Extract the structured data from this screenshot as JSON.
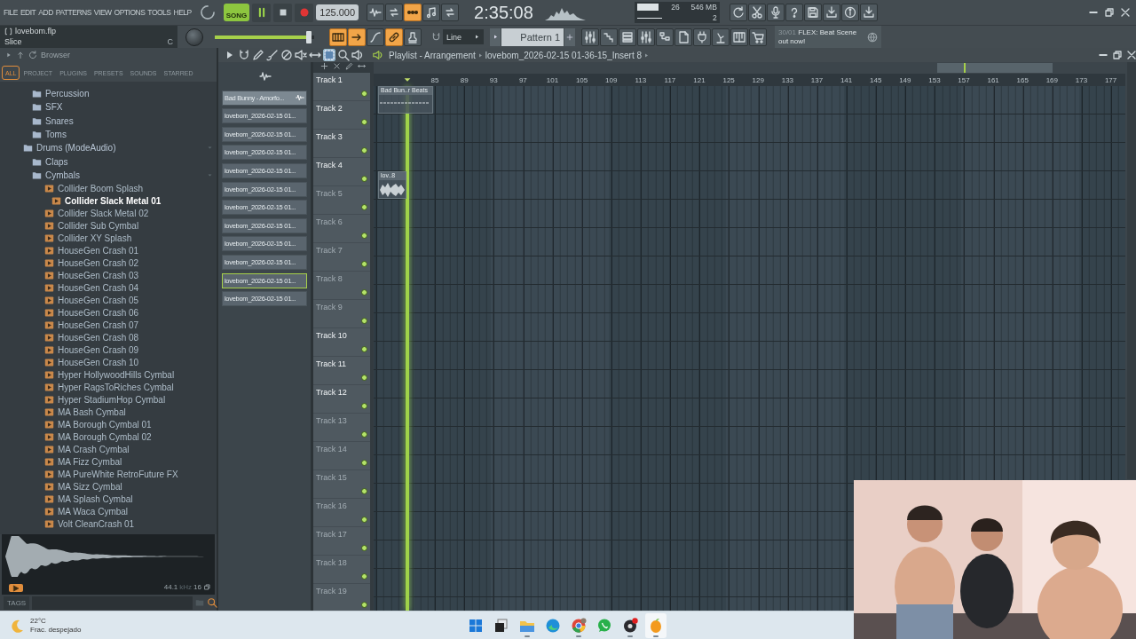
{
  "menu": [
    "FILE",
    "EDIT",
    "ADD",
    "PATTERNS",
    "VIEW",
    "OPTIONS",
    "TOOLS",
    "HELP"
  ],
  "transport": {
    "mode": "SONG",
    "playing": true,
    "tempo": "125.000"
  },
  "time": "2:35:08",
  "monitor": {
    "readings": [
      "26",
      "546 MB",
      "2"
    ]
  },
  "hint": {
    "title": "lovebom.flp",
    "text": "Slice",
    "shortcut": "C"
  },
  "master": {
    "level": 0.97
  },
  "snap": "Line",
  "pattern": "Pattern 1",
  "news": {
    "date": "30/01",
    "text": "FLEX: Beat Scene out now!"
  },
  "browser": {
    "title": "Browser",
    "tabs": [
      {
        "label": "ALL",
        "selected": true
      },
      {
        "label": "PROJECT",
        "selected": false
      },
      {
        "label": "PLUGINS",
        "selected": false
      },
      {
        "label": "PRESETS",
        "selected": false
      },
      {
        "label": "SOUNDS",
        "selected": false
      },
      {
        "label": "STARRED",
        "selected": false
      }
    ],
    "tree_above": [
      {
        "label": "Percussion"
      },
      {
        "label": "SFX"
      },
      {
        "label": "Snares"
      },
      {
        "label": "Toms"
      }
    ],
    "tree": [
      {
        "label": "Drums (ModeAudio)",
        "kind": "folder",
        "expanded": true,
        "children": [
          {
            "label": "Claps",
            "kind": "folder",
            "expanded": false
          },
          {
            "label": "Cymbals",
            "kind": "folder",
            "expanded": true,
            "children": [
              {
                "label": "Collider Boom Splash",
                "kind": "audio",
                "selected": false
              },
              {
                "label": "Collider Slack Metal 01",
                "kind": "audio",
                "selected": true
              },
              {
                "label": "Collider Slack Metal 02",
                "kind": "audio",
                "selected": false
              },
              {
                "label": "Collider Sub Cymbal",
                "kind": "audio",
                "selected": false
              },
              {
                "label": "Collider XY Splash",
                "kind": "audio",
                "selected": false
              },
              {
                "label": "HouseGen Crash 01",
                "kind": "audio",
                "selected": false
              },
              {
                "label": "HouseGen Crash 02",
                "kind": "audio",
                "selected": false
              },
              {
                "label": "HouseGen Crash 03",
                "kind": "audio",
                "selected": false
              },
              {
                "label": "HouseGen Crash 04",
                "kind": "audio",
                "selected": false
              },
              {
                "label": "HouseGen Crash 05",
                "kind": "audio",
                "selected": false
              },
              {
                "label": "HouseGen Crash 06",
                "kind": "audio",
                "selected": false
              },
              {
                "label": "HouseGen Crash 07",
                "kind": "audio",
                "selected": false
              },
              {
                "label": "HouseGen Crash 08",
                "kind": "audio",
                "selected": false
              },
              {
                "label": "HouseGen Crash 09",
                "kind": "audio",
                "selected": false
              },
              {
                "label": "HouseGen Crash 10",
                "kind": "audio",
                "selected": false
              },
              {
                "label": "Hyper HollywoodHills Cymbal",
                "kind": "audio",
                "selected": false
              },
              {
                "label": "Hyper RagsToRiches Cymbal",
                "kind": "audio",
                "selected": false
              },
              {
                "label": "Hyper StadiumHop Cymbal",
                "kind": "audio",
                "selected": false
              },
              {
                "label": "MA Bash Cymbal",
                "kind": "audio",
                "selected": false
              },
              {
                "label": "MA Borough Cymbal 01",
                "kind": "audio",
                "selected": false
              },
              {
                "label": "MA Borough Cymbal 02",
                "kind": "audio",
                "selected": false
              },
              {
                "label": "MA Crash Cymbal",
                "kind": "audio",
                "selected": false
              },
              {
                "label": "MA Fizz Cymbal",
                "kind": "audio",
                "selected": false
              },
              {
                "label": "MA PureWhite RetroFuture FX",
                "kind": "audio",
                "selected": false
              },
              {
                "label": "MA Sizz Cymbal",
                "kind": "audio",
                "selected": false
              },
              {
                "label": "MA Splash Cymbal",
                "kind": "audio",
                "selected": false
              },
              {
                "label": "MA Waca Cymbal",
                "kind": "audio",
                "selected": false
              },
              {
                "label": "Volt CleanCrash 01",
                "kind": "audio",
                "selected": false
              }
            ]
          }
        ]
      }
    ],
    "preview": {
      "rate": "44.1",
      "unit": "kHz",
      "bits": "16"
    },
    "tags_label": "TAGS"
  },
  "playlist": {
    "title": "Playlist - Arrangement",
    "breadcrumb": "lovebom_2026-02-15 01-36-15_Insert 8",
    "clip_sources": [
      {
        "label": "Bad Bunny - Amorfo...",
        "selected": false,
        "active": true
      },
      {
        "label": "lovebom_2026-02-15 01...",
        "selected": false,
        "active": false
      },
      {
        "label": "lovebom_2026-02-15 01...",
        "selected": false,
        "active": false
      },
      {
        "label": "lovebom_2026-02-15 01...",
        "selected": false,
        "active": false
      },
      {
        "label": "lovebom_2026-02-15 01...",
        "selected": false,
        "active": false
      },
      {
        "label": "lovebom_2026-02-15 01...",
        "selected": false,
        "active": false
      },
      {
        "label": "lovebom_2026-02-15 01...",
        "selected": false,
        "active": false
      },
      {
        "label": "lovebom_2026-02-15 01...",
        "selected": false,
        "active": false
      },
      {
        "label": "lovebom_2026-02-15 01...",
        "selected": false,
        "active": false
      },
      {
        "label": "lovebom_2026-02-15 01...",
        "selected": false,
        "active": false
      },
      {
        "label": "lovebom_2026-02-15 01...",
        "selected": true,
        "active": false
      },
      {
        "label": "lovebom_2026-02-15 01...",
        "selected": false,
        "active": false
      }
    ],
    "ruler": [
      "85",
      "89",
      "93",
      "97",
      "101",
      "105",
      "109",
      "113",
      "117",
      "121",
      "125",
      "129",
      "133",
      "137",
      "141",
      "145",
      "149",
      "153",
      "157",
      "161",
      "165",
      "169",
      "173",
      "177"
    ],
    "playhead": {
      "level": 0.045
    },
    "tracks": [
      {
        "name": "Track 1",
        "active": true,
        "clips": [
          {
            "label": "Bad Bun..r Beats",
            "kind": "automation"
          }
        ]
      },
      {
        "name": "Track 2",
        "active": true
      },
      {
        "name": "Track 3",
        "active": true
      },
      {
        "name": "Track 4",
        "active": true,
        "clips": [
          {
            "label": "lov..8",
            "kind": "audio"
          }
        ]
      },
      {
        "name": "Track 5",
        "active": false
      },
      {
        "name": "Track 6",
        "active": false
      },
      {
        "name": "Track 7",
        "active": false
      },
      {
        "name": "Track 8",
        "active": false
      },
      {
        "name": "Track 9",
        "active": false
      },
      {
        "name": "Track 10",
        "active": true
      },
      {
        "name": "Track 11",
        "active": true
      },
      {
        "name": "Track 12",
        "active": true
      },
      {
        "name": "Track 13",
        "active": false
      },
      {
        "name": "Track 14",
        "active": false
      },
      {
        "name": "Track 15",
        "active": false
      },
      {
        "name": "Track 16",
        "active": false
      },
      {
        "name": "Track 17",
        "active": false
      },
      {
        "name": "Track 18",
        "active": false
      },
      {
        "name": "Track 19",
        "active": false
      }
    ]
  },
  "taskbar": {
    "weather": {
      "temperature": "22°C",
      "condition": "Frac. despejado"
    },
    "apps": [
      {
        "kind": "start",
        "running": false
      },
      {
        "kind": "task-view",
        "running": false
      },
      {
        "kind": "explorer",
        "running": true
      },
      {
        "kind": "edge",
        "running": false
      },
      {
        "kind": "chrome",
        "running": true
      },
      {
        "kind": "whatsapp",
        "running": false
      },
      {
        "kind": "obs",
        "running": true
      },
      {
        "kind": "fl-studio",
        "running": true
      }
    ]
  }
}
